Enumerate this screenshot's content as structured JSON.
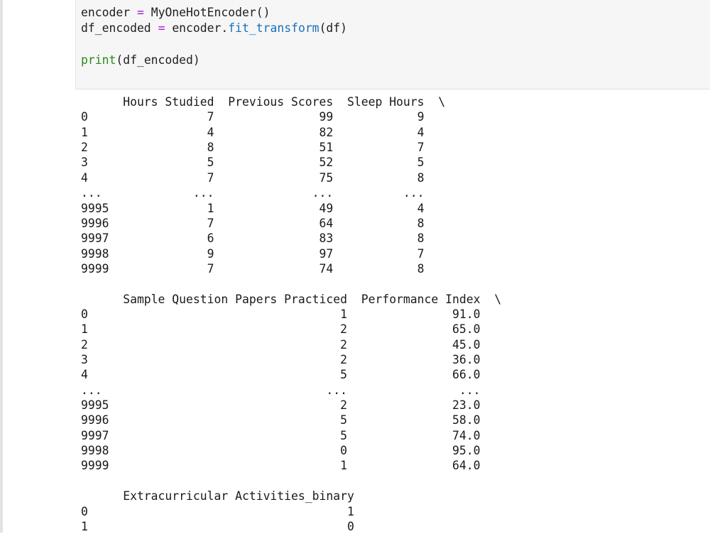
{
  "code_cell": {
    "line1": {
      "a": "encoder",
      "op": "=",
      "b": "MyOneHotEncoder()"
    },
    "line2": {
      "a": "df_encoded",
      "op": "=",
      "b": "encoder.",
      "attr": "fit_transform",
      "c": "(df)"
    },
    "line3": {
      "fn": "print",
      "args": "(df_encoded)"
    }
  },
  "output": {
    "lines": [
      "      Hours Studied  Previous Scores  Sleep Hours  \\",
      "0                 7               99            9   ",
      "1                 4               82            4   ",
      "2                 8               51            7   ",
      "3                 5               52            5   ",
      "4                 7               75            8   ",
      "...             ...              ...          ...   ",
      "9995              1               49            4   ",
      "9996              7               64            8   ",
      "9997              6               83            8   ",
      "9998              9               97            7   ",
      "9999              7               74            8   ",
      "",
      "      Sample Question Papers Practiced  Performance Index  \\",
      "0                                    1               91.0   ",
      "1                                    2               65.0   ",
      "2                                    2               45.0   ",
      "3                                    2               36.0   ",
      "4                                    5               66.0   ",
      "...                                ...                ...   ",
      "9995                                 2               23.0   ",
      "9996                                 5               58.0   ",
      "9997                                 5               74.0   ",
      "9998                                 0               95.0   ",
      "9999                                 1               64.0   ",
      "",
      "      Extracurricular Activities_binary  ",
      "0                                     1  ",
      "1                                     0  "
    ]
  }
}
